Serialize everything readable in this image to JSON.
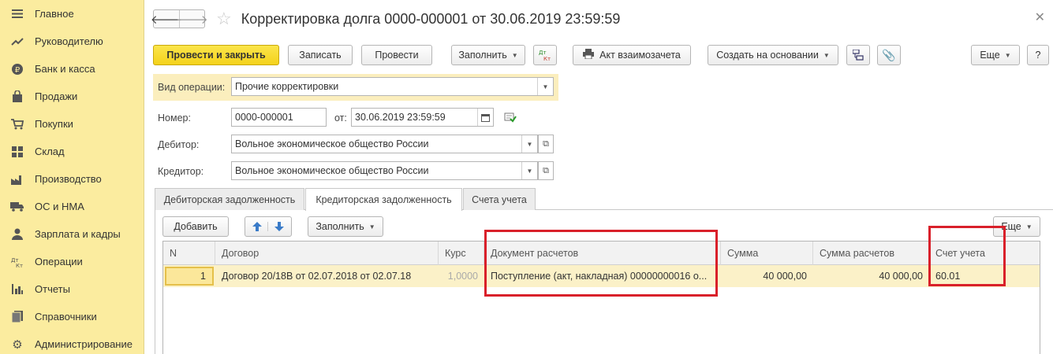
{
  "sidebar": {
    "items": [
      {
        "label": "Главное",
        "icon": "menu-icon"
      },
      {
        "label": "Руководителю",
        "icon": "trend-icon"
      },
      {
        "label": "Банк и касса",
        "icon": "ruble-icon"
      },
      {
        "label": "Продажи",
        "icon": "shopping-bag-icon"
      },
      {
        "label": "Покупки",
        "icon": "cart-icon"
      },
      {
        "label": "Склад",
        "icon": "warehouse-icon"
      },
      {
        "label": "Производство",
        "icon": "factory-icon"
      },
      {
        "label": "ОС и НМА",
        "icon": "truck-icon"
      },
      {
        "label": "Зарплата и кадры",
        "icon": "person-icon"
      },
      {
        "label": "Операции",
        "icon": "dt-kt-icon"
      },
      {
        "label": "Отчеты",
        "icon": "bar-chart-icon"
      },
      {
        "label": "Справочники",
        "icon": "book-icon"
      },
      {
        "label": "Администрирование",
        "icon": "gear-icon"
      }
    ]
  },
  "header": {
    "title": "Корректировка долга 0000-000001 от 30.06.2019 23:59:59"
  },
  "toolbar": {
    "post_close": "Провести и закрыть",
    "save": "Записать",
    "post": "Провести",
    "fill": "Заполнить",
    "act": "Акт взаимозачета",
    "create_based": "Создать на основании",
    "more": "Еще",
    "help": "?"
  },
  "form": {
    "op_type_label": "Вид операции:",
    "op_type_value": "Прочие корректировки",
    "number_label": "Номер:",
    "number_value": "0000-000001",
    "date_label": "от:",
    "date_value": "30.06.2019 23:59:59",
    "debtor_label": "Дебитор:",
    "debtor_value": "Вольное экономическое общество России",
    "creditor_label": "Кредитор:",
    "creditor_value": "Вольное экономическое общество России"
  },
  "tabs": [
    {
      "label": "Дебиторская задолженность"
    },
    {
      "label": "Кредиторская задолженность"
    },
    {
      "label": "Счета учета"
    }
  ],
  "grid_toolbar": {
    "add": "Добавить",
    "fill": "Заполнить",
    "more": "Еще"
  },
  "table": {
    "columns": [
      "N",
      "Договор",
      "Курс",
      "Документ расчетов",
      "Сумма",
      "Сумма расчетов",
      "Счет учета"
    ],
    "rows": [
      {
        "n": "1",
        "contract": "Договор 20/18В от 02.07.2018 от 02.07.18",
        "rate": "1,0000",
        "doc": "Поступление (акт, накладная) 00000000016 о...",
        "sum": "40 000,00",
        "settle_sum": "40 000,00",
        "account": "60.01"
      }
    ]
  },
  "colors": {
    "sidebar_bg": "#fbec9f",
    "primary_button": "#f4d21c",
    "highlight_box": "#d9202a",
    "selected_row": "#fbf1c8"
  }
}
